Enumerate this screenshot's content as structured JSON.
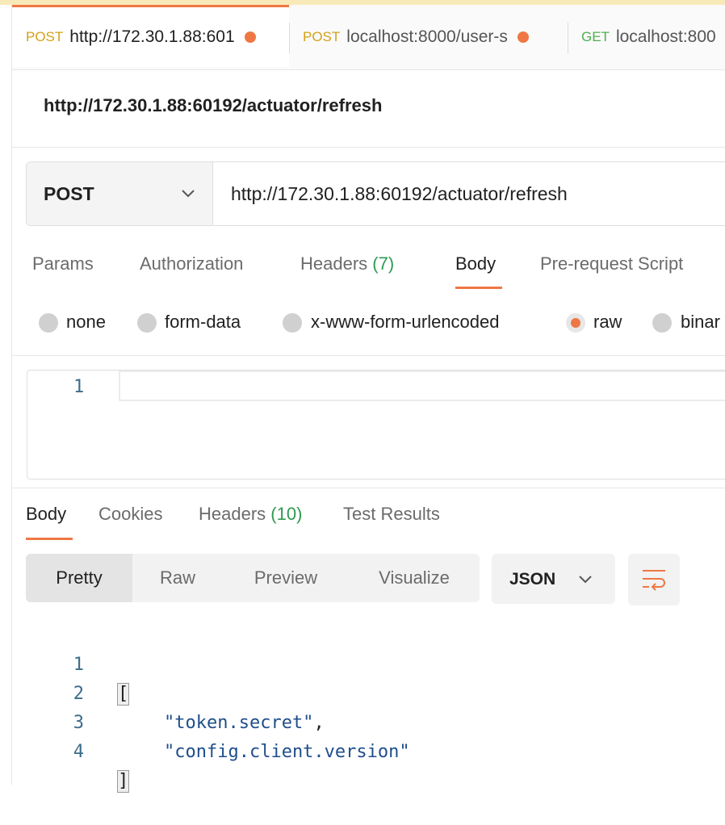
{
  "tabs": [
    {
      "method": "POST",
      "url": "http://172.30.1.88:601",
      "unsaved": true,
      "active": true
    },
    {
      "method": "POST",
      "url": "localhost:8000/user-s",
      "unsaved": true,
      "active": false
    },
    {
      "method": "GET",
      "url": "localhost:800",
      "unsaved": false,
      "active": false
    }
  ],
  "request": {
    "name": "http://172.30.1.88:60192/actuator/refresh",
    "method": "POST",
    "url": "http://172.30.1.88:60192/actuator/refresh",
    "tabs": {
      "params": "Params",
      "authorization": "Authorization",
      "headers": "Headers",
      "headers_count": "(7)",
      "body": "Body",
      "prerequest": "Pre-request Script"
    },
    "body_types": {
      "none": "none",
      "form_data": "form-data",
      "urlencoded": "x-www-form-urlencoded",
      "raw": "raw",
      "binary": "binar"
    },
    "selected_body_type": "raw",
    "editor_line": "1"
  },
  "response": {
    "tabs": {
      "body": "Body",
      "cookies": "Cookies",
      "headers": "Headers",
      "headers_count": "(10)",
      "tests": "Test Results"
    },
    "view_modes": {
      "pretty": "Pretty",
      "raw": "Raw",
      "preview": "Preview",
      "visualize": "Visualize"
    },
    "active_view": "Pretty",
    "language": "JSON",
    "lines": [
      {
        "num": "1",
        "text": "["
      },
      {
        "num": "2",
        "text": "\"token.secret\"",
        "suffix": ","
      },
      {
        "num": "3",
        "text": "\"config.client.version\""
      },
      {
        "num": "4",
        "text": "]"
      }
    ]
  },
  "colors": {
    "accent": "#ee7744",
    "post": "#d4a017",
    "get": "#4caf50",
    "count": "#2e9b4f",
    "string": "#1f4e8c"
  }
}
